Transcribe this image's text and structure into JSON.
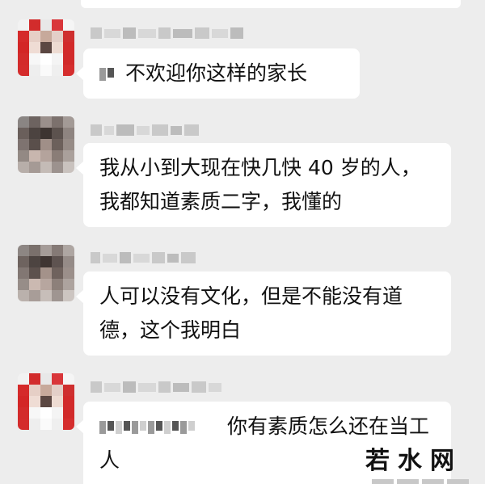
{
  "colors": {
    "background": "#ededed",
    "bubble": "#ffffff",
    "text": "#111111"
  },
  "messages": [
    {
      "avatar_icon": "red-profile-avatar-pixelated",
      "sender_name_blurred": true,
      "text": "不欢迎你这样的家长",
      "has_blurred_prefix": true
    },
    {
      "avatar_icon": "gray-profile-avatar-pixelated",
      "sender_name_blurred": true,
      "text": "我从小到大现在快几快 40 岁的人，我都知道素质二字，我懂的",
      "has_blurred_prefix": false
    },
    {
      "avatar_icon": "gray-profile-avatar-pixelated",
      "sender_name_blurred": true,
      "text": "人可以没有文化，但是不能没有道德，这个我明白",
      "has_blurred_prefix": false
    },
    {
      "avatar_icon": "red-profile-avatar-pixelated",
      "sender_name_blurred": true,
      "text": "你有素质怎么还在当工人",
      "has_blurred_prefix": true
    }
  ],
  "watermark": {
    "text": "若水网"
  }
}
